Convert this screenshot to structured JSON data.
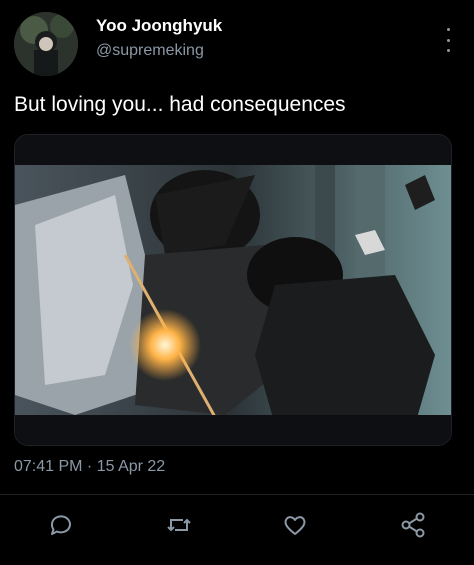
{
  "user": {
    "display_name": "Yoo Joonghyuk",
    "handle": "@supremeking",
    "avatar_icon": "avatar"
  },
  "tweet": {
    "text": "But loving you... had consequences",
    "timestamp": "07:41 PM · 15 Apr 22"
  },
  "media": {
    "description_icon": "illustration-image"
  },
  "actions": {
    "reply_icon": "reply-icon",
    "retweet_icon": "retweet-icon",
    "like_icon": "heart-icon",
    "share_icon": "share-icon"
  },
  "colors": {
    "background": "#000000",
    "text": "#ffffff",
    "muted": "#8b98a5"
  }
}
